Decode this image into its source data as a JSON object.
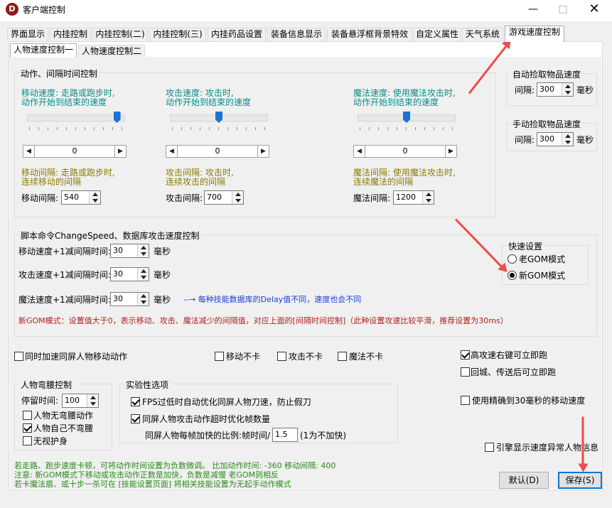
{
  "window": {
    "title": "客户端控制",
    "logo_letter": "D"
  },
  "tabs": [
    "界面显示",
    "内挂控制",
    "内挂控制(二)",
    "内挂控制(三)",
    "内挂药品设置",
    "装备信息显示",
    "装备悬浮框背景特效",
    "自定义属性",
    "天气系统",
    "游戏速度控制"
  ],
  "subtabs": [
    "人物速度控制一",
    "人物速度控制二"
  ],
  "action_group": {
    "label": "动作、间隔时间控制",
    "move": {
      "desc1": "移动速度: 走路或跑步时,",
      "desc2": "动作开始到结束的速度",
      "value": "0",
      "thumb": 0.95,
      "int_desc1": "移动间隔: 走路或跑步时,",
      "int_desc2": "连续移动的间隔",
      "int_label": "移动间隔:",
      "int_value": "540"
    },
    "attack": {
      "desc1": "攻击速度: 攻击时,",
      "desc2": "动作开始到结束的速度",
      "value": "0",
      "thumb": 0.5,
      "int_desc1": "攻击间隔: 攻击时,",
      "int_desc2": "连续攻击的间隔",
      "int_label": "攻击间隔:",
      "int_value": "700"
    },
    "magic": {
      "desc1": "魔法速度: 使用魔法攻击时,",
      "desc2": "动作开始到结束的速度",
      "value": "0",
      "thumb": 0.5,
      "int_desc1": "魔法间隔: 使用魔法攻击时,",
      "int_desc2": "连续魔法的间隔",
      "int_label": "魔法间隔:",
      "int_value": "1200"
    }
  },
  "auto_pickup": {
    "label": "自动捡取物品速度",
    "field_label": "间隔:",
    "value": "300",
    "unit": "毫秒"
  },
  "manual_pickup": {
    "label": "手动捡取物品速度",
    "field_label": "间隔:",
    "value": "300",
    "unit": "毫秒"
  },
  "script_group": {
    "label": "脚本命令ChangeSpeed、数据库攻击速度控制",
    "move_label": "移动速度+1减间隔时间:",
    "move_value": "30",
    "attack_label": "攻击速度+1减间隔时间:",
    "attack_value": "30",
    "magic_label": "魔法速度+1减间隔时间:",
    "magic_value": "30",
    "unit": "毫秒",
    "note": "--→ 每种技能数据库的Delay值不同，速度也会不同",
    "gom_note": "新GOM模式：设置值大于0，表示移动、攻击、魔法减少的间隔值，对应上面的[间隔时间控制]（此种设置攻速比较平滑，推荐设置为30ms）"
  },
  "quick": {
    "label": "快速设置",
    "opt_old": "老GOM模式",
    "opt_new": "新GOM模式",
    "selected": "new"
  },
  "checks": {
    "sync_move": {
      "label": "同时加速同屏人物移动动作",
      "checked": false
    },
    "move_nolag": {
      "label": "移动不卡",
      "checked": false
    },
    "attack_nolag": {
      "label": "攻击不卡",
      "checked": false
    },
    "magic_nolag": {
      "label": "魔法不卡",
      "checked": false
    },
    "high_right": {
      "label": "高攻速右键可立即跑",
      "checked": true
    },
    "return_run": {
      "label": "回城、传送后可立即跑",
      "checked": false
    },
    "precise": {
      "label": "使用精确到30毫秒的移动速度",
      "checked": false
    },
    "engine_warn": {
      "label": "引擎显示速度异常人物信息",
      "checked": false
    }
  },
  "bend_group": {
    "label": "人物弯腰控制",
    "stay_label": "停留时间:",
    "stay_value": "100",
    "no_bend": {
      "label": "人物无弯腰动作",
      "checked": false
    },
    "self_no_bend": {
      "label": "人物自己不弯腰",
      "checked": true
    },
    "ignore_shield": {
      "label": "无视护身",
      "checked": false
    }
  },
  "exp_group": {
    "label": "实验性选项",
    "fps": {
      "label": "FPS过低时自动优化同屏人物刀速，防止假刀",
      "checked": true
    },
    "timeout": {
      "label": "同屏人物攻击动作超时优化帧数量",
      "checked": true
    },
    "ratio_label": "同屏人物每帧加快的比例:帧时间/",
    "ratio_value": "1.5",
    "ratio_note": "(1为不加快)"
  },
  "footer": {
    "line1": "若走路、跑步速度卡顿，可将动作时间设置为负数微调。 比加动作时间: -360  移动间隔: 400",
    "line2": "注意: 新GOM模式下移动或攻击动作正数是加快，负数是减慢  老GOM则相反",
    "line3": "若卡魔法盾、或十步一杀可在 [技能设置页面] 将相关技能设置为无起手动作模式"
  },
  "buttons": {
    "default": "默认(D)",
    "save": "保存(S)"
  },
  "colors": {
    "accent": "#0078d7",
    "teal_text": "#0a8a8a",
    "olive_text": "#8a7a00",
    "red_text": "#b02020",
    "green_text": "#2a8a1a",
    "annotation_arrow": "#ef4a4a"
  }
}
